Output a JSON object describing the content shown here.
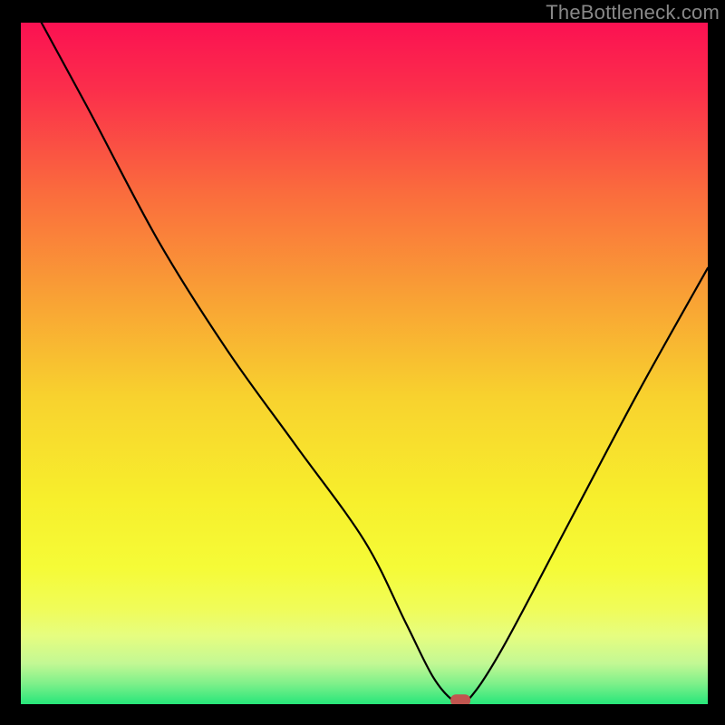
{
  "watermark": "TheBottleneck.com",
  "chart_data": {
    "type": "line",
    "title": "",
    "xlabel": "",
    "ylabel": "",
    "xlim": [
      0,
      100
    ],
    "ylim": [
      0,
      100
    ],
    "x": [
      3,
      10,
      20,
      30,
      40,
      50,
      56,
      60,
      63,
      65,
      70,
      80,
      90,
      100
    ],
    "values": [
      100,
      87,
      68,
      52,
      38,
      24,
      12,
      4,
      0.5,
      0.5,
      8,
      27,
      46,
      64
    ],
    "marker": {
      "x": 64,
      "y": 0.5
    },
    "background": "green-yellow-red vertical gradient",
    "grid": false,
    "legend": false
  },
  "colors": {
    "black": "#000000",
    "marker": "#c1554f",
    "band_green": "#27e67a"
  }
}
